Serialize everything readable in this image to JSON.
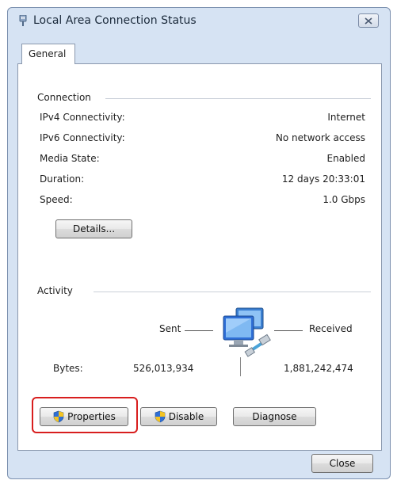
{
  "window": {
    "title": "Local Area Connection Status",
    "close_icon": "close-icon"
  },
  "tabs": [
    {
      "label": "General",
      "selected": true
    }
  ],
  "connection": {
    "group_label": "Connection",
    "rows": [
      {
        "label": "IPv4 Connectivity:",
        "value": "Internet"
      },
      {
        "label": "IPv6 Connectivity:",
        "value": "No network access"
      },
      {
        "label": "Media State:",
        "value": "Enabled"
      },
      {
        "label": "Duration:",
        "value": "12 days 20:33:01"
      },
      {
        "label": "Speed:",
        "value": "1.0 Gbps"
      }
    ],
    "details_button": "Details..."
  },
  "activity": {
    "group_label": "Activity",
    "sent_label": "Sent",
    "received_label": "Received",
    "bytes_label": "Bytes:",
    "bytes_sent": "526,013,934",
    "bytes_received": "1,881,242,474",
    "icon": "network-computers-icon"
  },
  "buttons": {
    "properties": "Properties",
    "disable": "Disable",
    "diagnose": "Diagnose",
    "close": "Close"
  },
  "colors": {
    "window_frame": "#d6e3f3",
    "highlight": "#d81e1e",
    "shield_blue": "#2f6fd6",
    "shield_yellow": "#f3c324"
  }
}
